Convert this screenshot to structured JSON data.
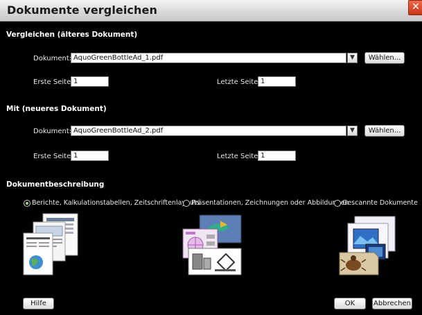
{
  "window": {
    "title": "Dokumente vergleichen",
    "close_glyph": "✕"
  },
  "older": {
    "heading": "Vergleichen (älteres Dokument)",
    "doc_label": "Dokument:",
    "doc_value": "AquoGreenBottleAd_1.pdf",
    "choose_label": "Wählen...",
    "first_label": "Erste Seite:",
    "first_value": "1",
    "last_label": "Letzte Seite:",
    "last_value": "1"
  },
  "newer": {
    "heading": "Mit (neueres Dokument)",
    "doc_label": "Dokument:",
    "doc_value": "AquoGreenBottleAd_2.pdf",
    "choose_label": "Wählen...",
    "first_label": "Erste Seite:",
    "first_value": "1",
    "last_label": "Letzte Seite:",
    "last_value": "1"
  },
  "description": {
    "heading": "Dokumentbeschreibung",
    "options": [
      {
        "label": "Berichte, Kalkulationstabellen, Zeitschriftenlayouts",
        "selected": true,
        "icon": "reports-icon"
      },
      {
        "label": "Präsentationen, Zeichnungen oder Abbildungen",
        "selected": false,
        "icon": "presentations-icon"
      },
      {
        "label": "Gescannte Dokumente",
        "selected": false,
        "icon": "scanned-documents-icon"
      }
    ]
  },
  "footer": {
    "help_label": "Hilfe",
    "ok_label": "OK",
    "cancel_label": "Abbrechen"
  },
  "colors": {
    "background": "#000000",
    "radio_selected": "#9ddc7a",
    "close": "#d0462a"
  }
}
